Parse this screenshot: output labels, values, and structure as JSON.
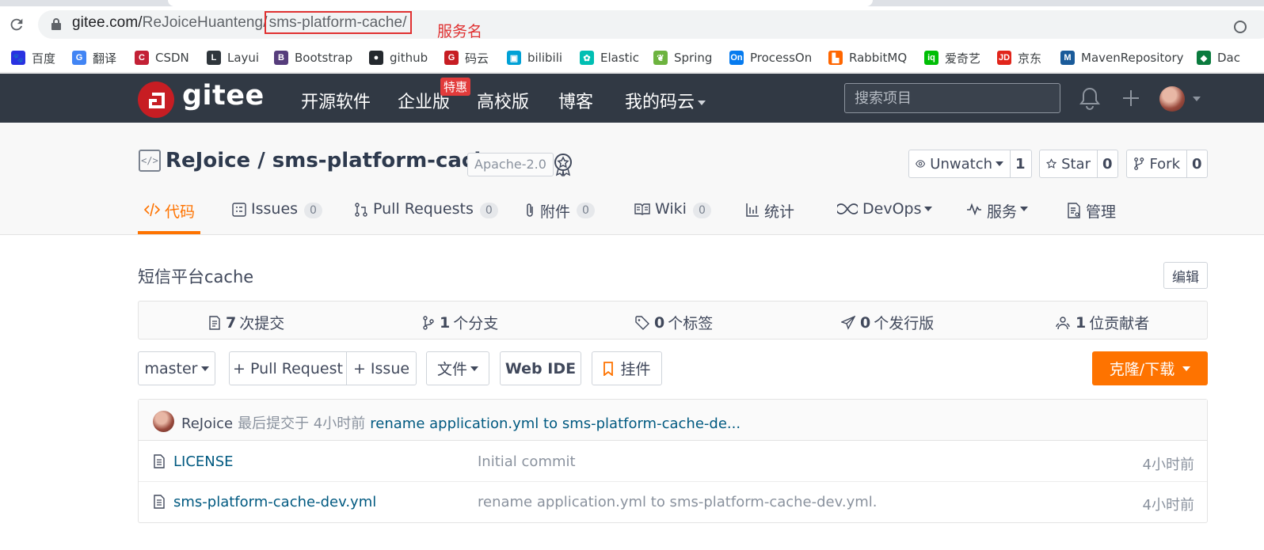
{
  "browser": {
    "url_host": "gitee.com/",
    "url_path_a": "ReJoiceHuanteng/",
    "url_path_b": "sms-platform-cache/",
    "annotation": "服务名",
    "bookmarks": [
      {
        "label": "百度",
        "icon": "baidu-icon",
        "color": "#2932e1"
      },
      {
        "label": "翻译",
        "icon": "translate-icon",
        "color": "#4285f4"
      },
      {
        "label": "CSDN",
        "icon": "csdn-icon",
        "color": "#c32136"
      },
      {
        "label": "Layui",
        "icon": "layui-icon",
        "color": "#2f363c"
      },
      {
        "label": "Bootstrap",
        "icon": "bootstrap-icon",
        "color": "#563d7c"
      },
      {
        "label": "github",
        "icon": "github-icon",
        "color": "#24292e"
      },
      {
        "label": "码云",
        "icon": "gitee-icon",
        "color": "#c71d23"
      },
      {
        "label": "bilibili",
        "icon": "bilibili-icon",
        "color": "#00a1d6"
      },
      {
        "label": "Elastic",
        "icon": "elastic-icon",
        "color": "#00bfb3"
      },
      {
        "label": "Spring",
        "icon": "spring-icon",
        "color": "#6db33f"
      },
      {
        "label": "ProcessOn",
        "icon": "processon-icon",
        "color": "#067bef"
      },
      {
        "label": "RabbitMQ",
        "icon": "rabbitmq-icon",
        "color": "#ff6600"
      },
      {
        "label": "爱奇艺",
        "icon": "iqiyi-icon",
        "color": "#00be06"
      },
      {
        "label": "京东",
        "icon": "jd-icon",
        "color": "#e1251b"
      },
      {
        "label": "MavenRepository",
        "icon": "maven-icon",
        "color": "#1a5b9a"
      },
      {
        "label": "Dac",
        "icon": "dac-icon",
        "color": "#0a7b3e"
      }
    ]
  },
  "nav": {
    "logo": "gitee",
    "links": [
      "开源软件",
      "企业版",
      "高校版",
      "博客",
      "我的码云"
    ],
    "promo_badge": "特惠",
    "search_placeholder": "搜索项目"
  },
  "repo": {
    "title": "ReJoice / sms-platform-cache",
    "license": "Apache-2.0",
    "watch_label": "Unwatch",
    "watch_count": "1",
    "star_label": "Star",
    "star_count": "0",
    "fork_label": "Fork",
    "fork_count": "0",
    "tabs": [
      {
        "label": "代码",
        "count": null
      },
      {
        "label": "Issues",
        "count": "0"
      },
      {
        "label": "Pull Requests",
        "count": "0"
      },
      {
        "label": "附件",
        "count": "0"
      },
      {
        "label": "Wiki",
        "count": "0"
      },
      {
        "label": "统计",
        "count": null
      },
      {
        "label": "DevOps",
        "count": null
      },
      {
        "label": "服务",
        "count": null
      },
      {
        "label": "管理",
        "count": null
      }
    ],
    "description": "短信平台cache",
    "edit_label": "编辑",
    "stats": [
      {
        "num": "7",
        "label": "次提交"
      },
      {
        "num": "1",
        "label": "个分支"
      },
      {
        "num": "0",
        "label": "个标签"
      },
      {
        "num": "0",
        "label": "个发行版"
      },
      {
        "num": "1",
        "label": "位贡献者"
      }
    ],
    "toolbar": {
      "branch": "master",
      "pull_request": "+ Pull Request",
      "issue": "+ Issue",
      "file": "文件",
      "web_ide": "Web IDE",
      "widget": "挂件",
      "clone": "克隆/下载"
    },
    "last_commit": {
      "author": "ReJoice",
      "meta": "最后提交于 4小时前",
      "message": "rename application.yml to sms-platform-cache-de..."
    },
    "files": [
      {
        "name": "LICENSE",
        "commit": "Initial commit",
        "time": "4小时前"
      },
      {
        "name": "sms-platform-cache-dev.yml",
        "commit": "rename application.yml to sms-platform-cache-dev.yml.",
        "time": "4小时前"
      }
    ],
    "accent_color": "#fe7300",
    "nav_color": "#313944"
  }
}
